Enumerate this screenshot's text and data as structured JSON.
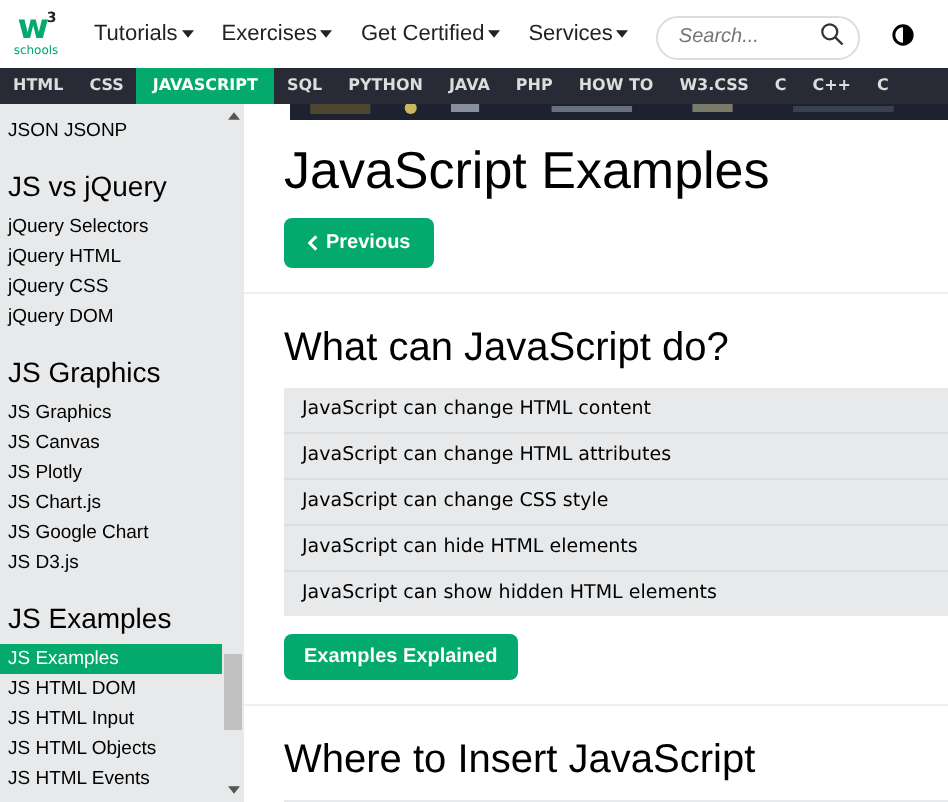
{
  "logo": {
    "mark": "w",
    "power": "3",
    "word": "schools"
  },
  "top_menu": [
    {
      "label": "Tutorials"
    },
    {
      "label": "Exercises"
    },
    {
      "label": "Get Certified"
    },
    {
      "label": "Services"
    }
  ],
  "search": {
    "placeholder": "Search..."
  },
  "nav": [
    {
      "label": "HTML",
      "selected": false
    },
    {
      "label": "CSS",
      "selected": false
    },
    {
      "label": "JAVASCRIPT",
      "selected": true
    },
    {
      "label": "SQL",
      "selected": false
    },
    {
      "label": "PYTHON",
      "selected": false
    },
    {
      "label": "JAVA",
      "selected": false
    },
    {
      "label": "PHP",
      "selected": false
    },
    {
      "label": "HOW TO",
      "selected": false
    },
    {
      "label": "W3.CSS",
      "selected": false
    },
    {
      "label": "C",
      "selected": false
    },
    {
      "label": "C++",
      "selected": false
    },
    {
      "label": "C",
      "selected": false
    }
  ],
  "sidebar": [
    {
      "kind": "link",
      "label": "JSON JSONP",
      "selected": false
    },
    {
      "kind": "heading",
      "label": "JS vs jQuery"
    },
    {
      "kind": "link",
      "label": "jQuery Selectors",
      "selected": false
    },
    {
      "kind": "link",
      "label": "jQuery HTML",
      "selected": false
    },
    {
      "kind": "link",
      "label": "jQuery CSS",
      "selected": false
    },
    {
      "kind": "link",
      "label": "jQuery DOM",
      "selected": false
    },
    {
      "kind": "heading",
      "label": "JS Graphics"
    },
    {
      "kind": "link",
      "label": "JS Graphics",
      "selected": false
    },
    {
      "kind": "link",
      "label": "JS Canvas",
      "selected": false
    },
    {
      "kind": "link",
      "label": "JS Plotly",
      "selected": false
    },
    {
      "kind": "link",
      "label": "JS Chart.js",
      "selected": false
    },
    {
      "kind": "link",
      "label": "JS Google Chart",
      "selected": false
    },
    {
      "kind": "link",
      "label": "JS D3.js",
      "selected": false
    },
    {
      "kind": "heading",
      "label": "JS Examples"
    },
    {
      "kind": "link",
      "label": "JS Examples",
      "selected": true
    },
    {
      "kind": "link",
      "label": "JS HTML DOM",
      "selected": false
    },
    {
      "kind": "link",
      "label": "JS HTML Input",
      "selected": false
    },
    {
      "kind": "link",
      "label": "JS HTML Objects",
      "selected": false
    },
    {
      "kind": "link",
      "label": "JS HTML Events",
      "selected": false
    }
  ],
  "main": {
    "title": "JavaScript Examples",
    "prev_button": "Previous",
    "sections": [
      {
        "heading": "What can JavaScript do?",
        "items": [
          "JavaScript can change HTML content",
          "JavaScript can change HTML attributes",
          "JavaScript can change CSS style",
          "JavaScript can hide HTML elements",
          "JavaScript can show hidden HTML elements"
        ],
        "button": "Examples Explained"
      },
      {
        "heading": "Where to Insert JavaScript"
      }
    ]
  }
}
